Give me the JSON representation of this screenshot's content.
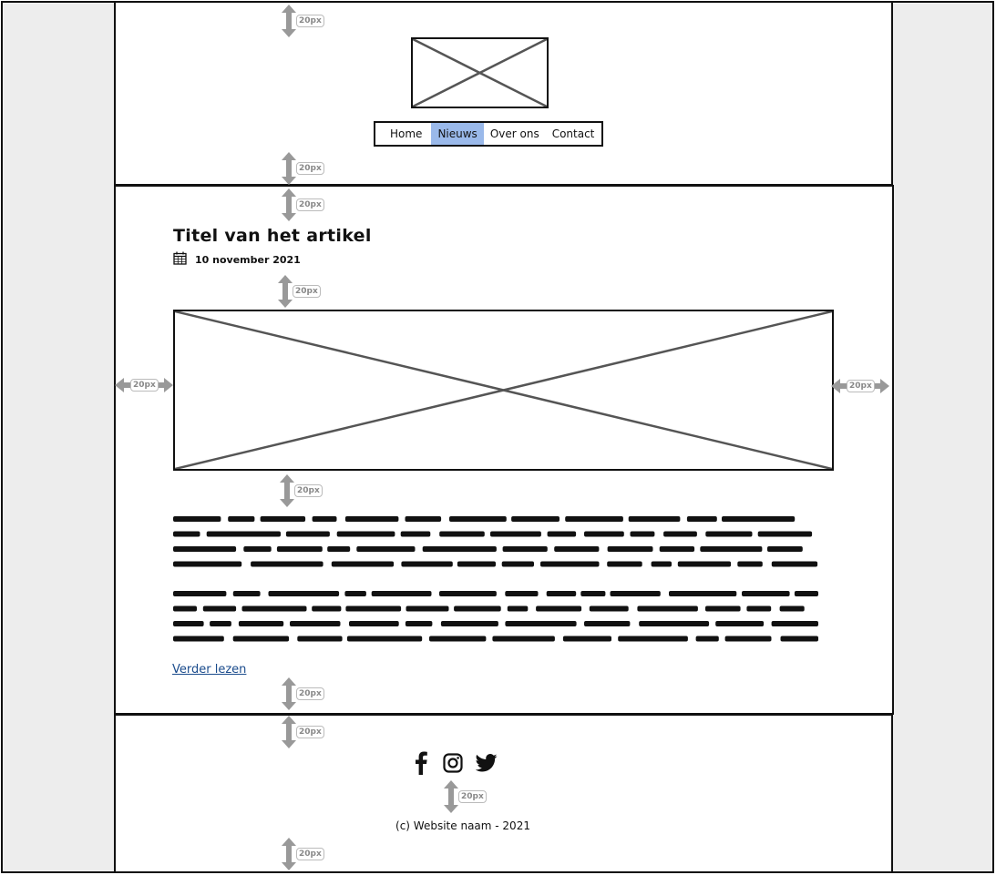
{
  "spacing_label": "20px",
  "nav": {
    "items": [
      "Home",
      "Nieuws",
      "Over ons",
      "Contact"
    ],
    "active": "Nieuws"
  },
  "article": {
    "title": "Titel van het artikel",
    "date": "10 november 2021",
    "read_more": "Verder lezen"
  },
  "footer": {
    "socials": [
      "facebook-icon",
      "instagram-icon",
      "twitter-icon"
    ],
    "copyright": "(c) Website naam - 2021"
  },
  "colors": {
    "nav_active": "#9ab9ea",
    "link": "#1a4b8c",
    "gutter": "#ededed"
  }
}
